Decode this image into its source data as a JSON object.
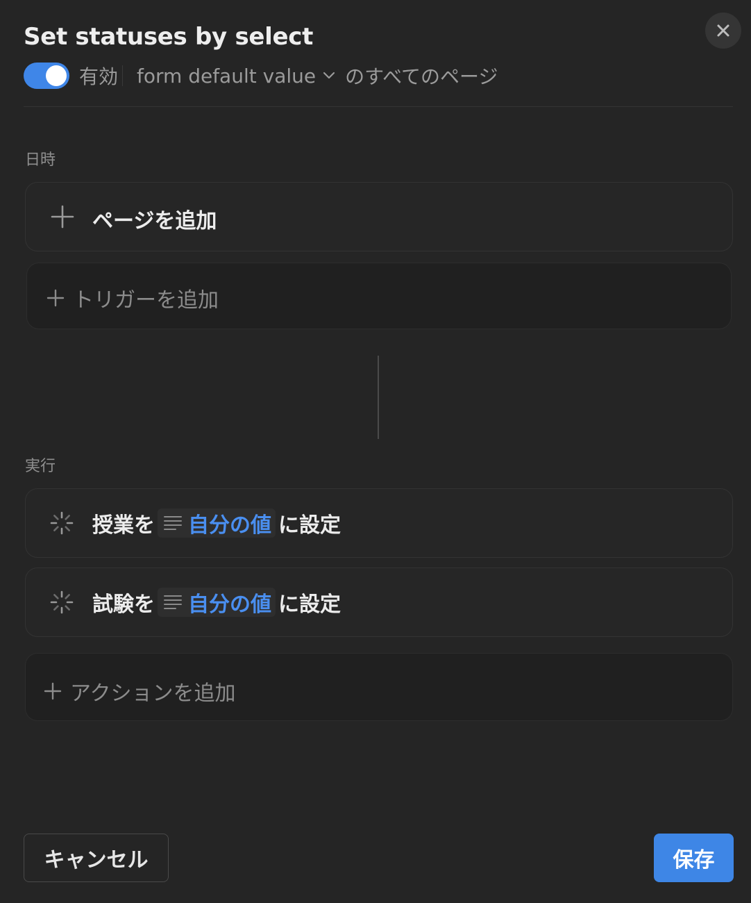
{
  "dialog": {
    "title": "Set statuses by select",
    "close_icon": "close-icon"
  },
  "meta": {
    "enabled": true,
    "enabled_label": "有効",
    "database_name": "form default value",
    "scope_label": "のすべてのページ"
  },
  "trigger_section": {
    "label": "日時",
    "page_trigger_label": "ページを追加",
    "add_trigger_label": "トリガーを追加"
  },
  "action_section": {
    "label": "実行",
    "actions": [
      {
        "property": "授業を",
        "value": "自分の値",
        "suffix": "に設定"
      },
      {
        "property": "試験を",
        "value": "自分の値",
        "suffix": "に設定"
      }
    ],
    "add_action_label": "アクションを追加"
  },
  "footer": {
    "cancel_label": "キャンセル",
    "save_label": "保存"
  },
  "colors": {
    "accent": "#3f86e8",
    "background": "#252525",
    "value_text": "#4a8ff0"
  }
}
